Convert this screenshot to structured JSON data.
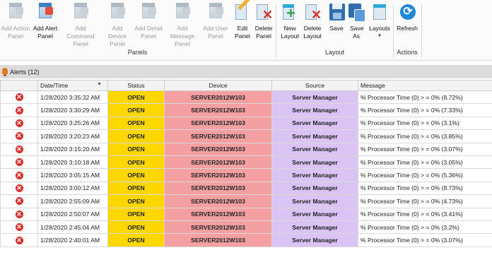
{
  "ribbon": {
    "buttons": [
      {
        "label": "Add Action Panel",
        "icon": "add-action-panel-icon"
      },
      {
        "label": "Add Alert Panel",
        "icon": "add-alert-panel-icon"
      },
      {
        "label": "Add Command Panel",
        "icon": "add-command-panel-icon"
      },
      {
        "label": "Add Device Panel",
        "icon": "add-device-panel-icon"
      },
      {
        "label": "Add Detail Panel",
        "icon": "add-detail-panel-icon"
      },
      {
        "label": "Add Message Panel",
        "icon": "add-message-panel-icon"
      },
      {
        "label": "Add User Panel",
        "icon": "add-user-panel-icon"
      },
      {
        "label": "Edit Panel",
        "icon": "edit-panel-icon"
      },
      {
        "label": "Delete Panel",
        "icon": "delete-panel-icon"
      },
      {
        "label": "New Layout",
        "icon": "new-layout-icon"
      },
      {
        "label": "Delete Layout",
        "icon": "delete-layout-icon"
      },
      {
        "label": "Save",
        "icon": "save-icon"
      },
      {
        "label": "Save As",
        "icon": "save-as-icon"
      },
      {
        "label": "Layouts",
        "icon": "layouts-icon"
      },
      {
        "label": "Refresh",
        "icon": "refresh-icon"
      }
    ],
    "groups": {
      "panels": "Panels",
      "layout": "Layout",
      "actions": "Actions"
    }
  },
  "alerts": {
    "title": "Alerts (12)",
    "columns": [
      "",
      "Date/Time",
      "Status",
      "Device",
      "Source",
      "Message"
    ],
    "rows": [
      {
        "datetime": "1/28/2020 3:35:32 AM",
        "status": "OPEN",
        "device": "SERVER2012W103",
        "source": "Server Manager",
        "message": "% Processor Time (0) > = 0% (8.72%)"
      },
      {
        "datetime": "1/28/2020 3:30:29 AM",
        "status": "OPEN",
        "device": "SERVER2012W103",
        "source": "Server Manager",
        "message": "% Processor Time (0) > = 0% (7.33%)"
      },
      {
        "datetime": "1/28/2020 3:25:26 AM",
        "status": "OPEN",
        "device": "SERVER2012W103",
        "source": "Server Manager",
        "message": "% Processor Time (0) > = 0% (3.1%)"
      },
      {
        "datetime": "1/28/2020 3:20:23 AM",
        "status": "OPEN",
        "device": "SERVER2012W103",
        "source": "Server Manager",
        "message": "% Processor Time (0) > = 0% (3.85%)"
      },
      {
        "datetime": "1/28/2020 3:15:20 AM",
        "status": "OPEN",
        "device": "SERVER2012W103",
        "source": "Server Manager",
        "message": "% Processor Time (0) > = 0% (3.07%)"
      },
      {
        "datetime": "1/28/2020 3:10:18 AM",
        "status": "OPEN",
        "device": "SERVER2012W103",
        "source": "Server Manager",
        "message": "% Processor Time (0) > = 0% (3.05%)"
      },
      {
        "datetime": "1/28/2020 3:05:15 AM",
        "status": "OPEN",
        "device": "SERVER2012W103",
        "source": "Server Manager",
        "message": "% Processor Time (0) > = 0% (5.36%)"
      },
      {
        "datetime": "1/28/2020 3:00:12 AM",
        "status": "OPEN",
        "device": "SERVER2012W103",
        "source": "Server Manager",
        "message": "% Processor Time (0) > = 0% (8.73%)"
      },
      {
        "datetime": "1/28/2020 2:55:09 AM",
        "status": "OPEN",
        "device": "SERVER2012W103",
        "source": "Server Manager",
        "message": "% Processor Time (0) > = 0% (4.73%)"
      },
      {
        "datetime": "1/28/2020 2:50:07 AM",
        "status": "OPEN",
        "device": "SERVER2012W103",
        "source": "Server Manager",
        "message": "% Processor Time (0) > = 0% (3.41%)"
      },
      {
        "datetime": "1/28/2020 2:45:04 AM",
        "status": "OPEN",
        "device": "SERVER2012W103",
        "source": "Server Manager",
        "message": "% Processor Time (0) > = 0% (3.2%)"
      },
      {
        "datetime": "1/28/2020 2:40:01 AM",
        "status": "OPEN",
        "device": "SERVER2012W103",
        "source": "Server Manager",
        "message": "% Processor Time (0) > = 0% (3.07%)"
      }
    ]
  },
  "colors": {
    "status_open": "#ffd700",
    "device_cell": "#f4a0a3",
    "source_cell": "#dcc3f5",
    "error_icon": "#d9302c"
  }
}
